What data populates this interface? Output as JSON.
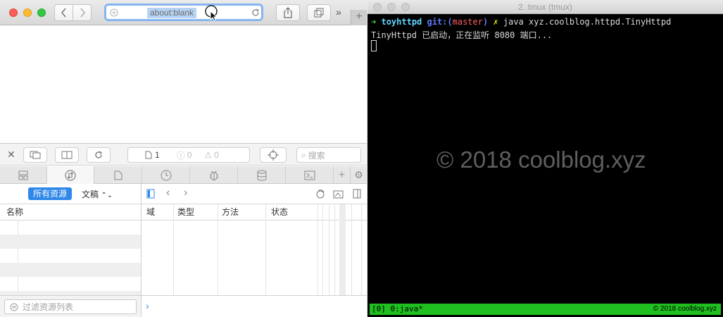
{
  "safari": {
    "url": "about:blank",
    "tab_overflow_icon": "chevrons-right-icon",
    "new_tab_label": "+"
  },
  "inspector": {
    "console_count": "1",
    "error_count": "0",
    "warning_count": "0",
    "search_placeholder": "搜索",
    "filter_all": "所有资源",
    "filter_type": "文稿",
    "left_column_header": "名称",
    "columns": [
      "域",
      "类型",
      "方法",
      "状态"
    ],
    "filter_placeholder": "过滤资源列表",
    "tabs": [
      "elements-icon",
      "network-icon",
      "resources-icon",
      "timeline-icon",
      "debugger-icon",
      "storage-icon",
      "console-icon"
    ]
  },
  "terminal": {
    "window_title": "2. tmux (tmux)",
    "prompt_arrow": "➜",
    "prompt_dir": "toyhttpd",
    "prompt_git": "git:(",
    "prompt_branch": "master",
    "prompt_git_close": ")",
    "prompt_dirty": "✗",
    "command": "java xyz.coolblog.httpd.TinyHttpd",
    "output_line": "TinyHttpd 已启动，正在监听 8080 端口...",
    "watermark": "© 2018 coolblog.xyz",
    "status_left": "[0] 0:java*",
    "status_right": "© 2018 coolblog.xyz"
  },
  "colors": {
    "url_focus": "#86b5ee",
    "prompt_green": "#3fd13f",
    "prompt_dir": "#5fd7ff",
    "git_blue": "#5c7cff",
    "branch_red": "#ff5f5f",
    "dirty_yellow": "#e5e510",
    "status_green": "#1fbf1f"
  }
}
